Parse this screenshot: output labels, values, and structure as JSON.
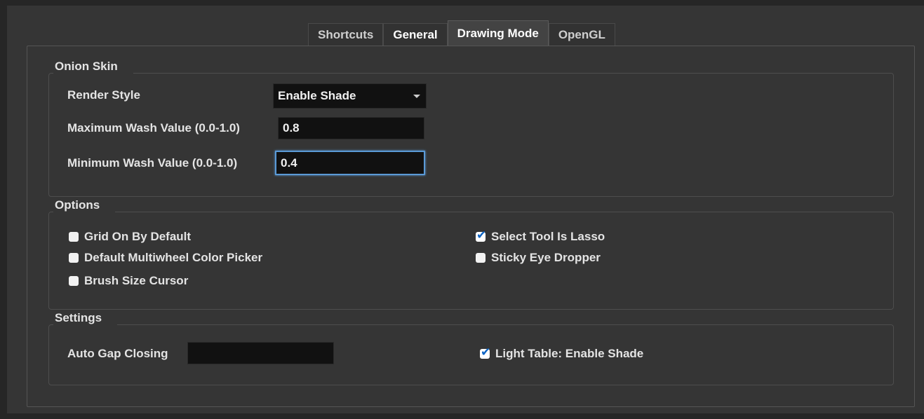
{
  "tabs": [
    {
      "label": "Shortcuts"
    },
    {
      "label": "General"
    },
    {
      "label": "Drawing Mode"
    },
    {
      "label": "OpenGL"
    }
  ],
  "onion_skin": {
    "title": "Onion Skin",
    "render_style_label": "Render Style",
    "render_style_value": "Enable Shade",
    "max_wash_label": "Maximum Wash Value (0.0-1.0)",
    "max_wash_value": "0.8",
    "min_wash_label": "Minimum Wash Value (0.0-1.0)",
    "min_wash_value": "0.4"
  },
  "options": {
    "title": "Options",
    "checkboxes": [
      {
        "label": "Grid On By Default",
        "checked": false
      },
      {
        "label": "Default Multiwheel Color Picker",
        "checked": false
      },
      {
        "label": "Brush Size Cursor",
        "checked": false
      },
      {
        "label": "Select Tool Is Lasso",
        "checked": true
      },
      {
        "label": "Sticky Eye Dropper",
        "checked": false
      }
    ]
  },
  "settings": {
    "title": "Settings",
    "auto_gap_label": "Auto Gap Closing",
    "auto_gap_value": "",
    "light_table": {
      "label": "Light Table: Enable Shade",
      "checked": true
    }
  },
  "icons": {
    "checkmark": "✔",
    "dropdown_caret": "chevron-down-icon"
  }
}
